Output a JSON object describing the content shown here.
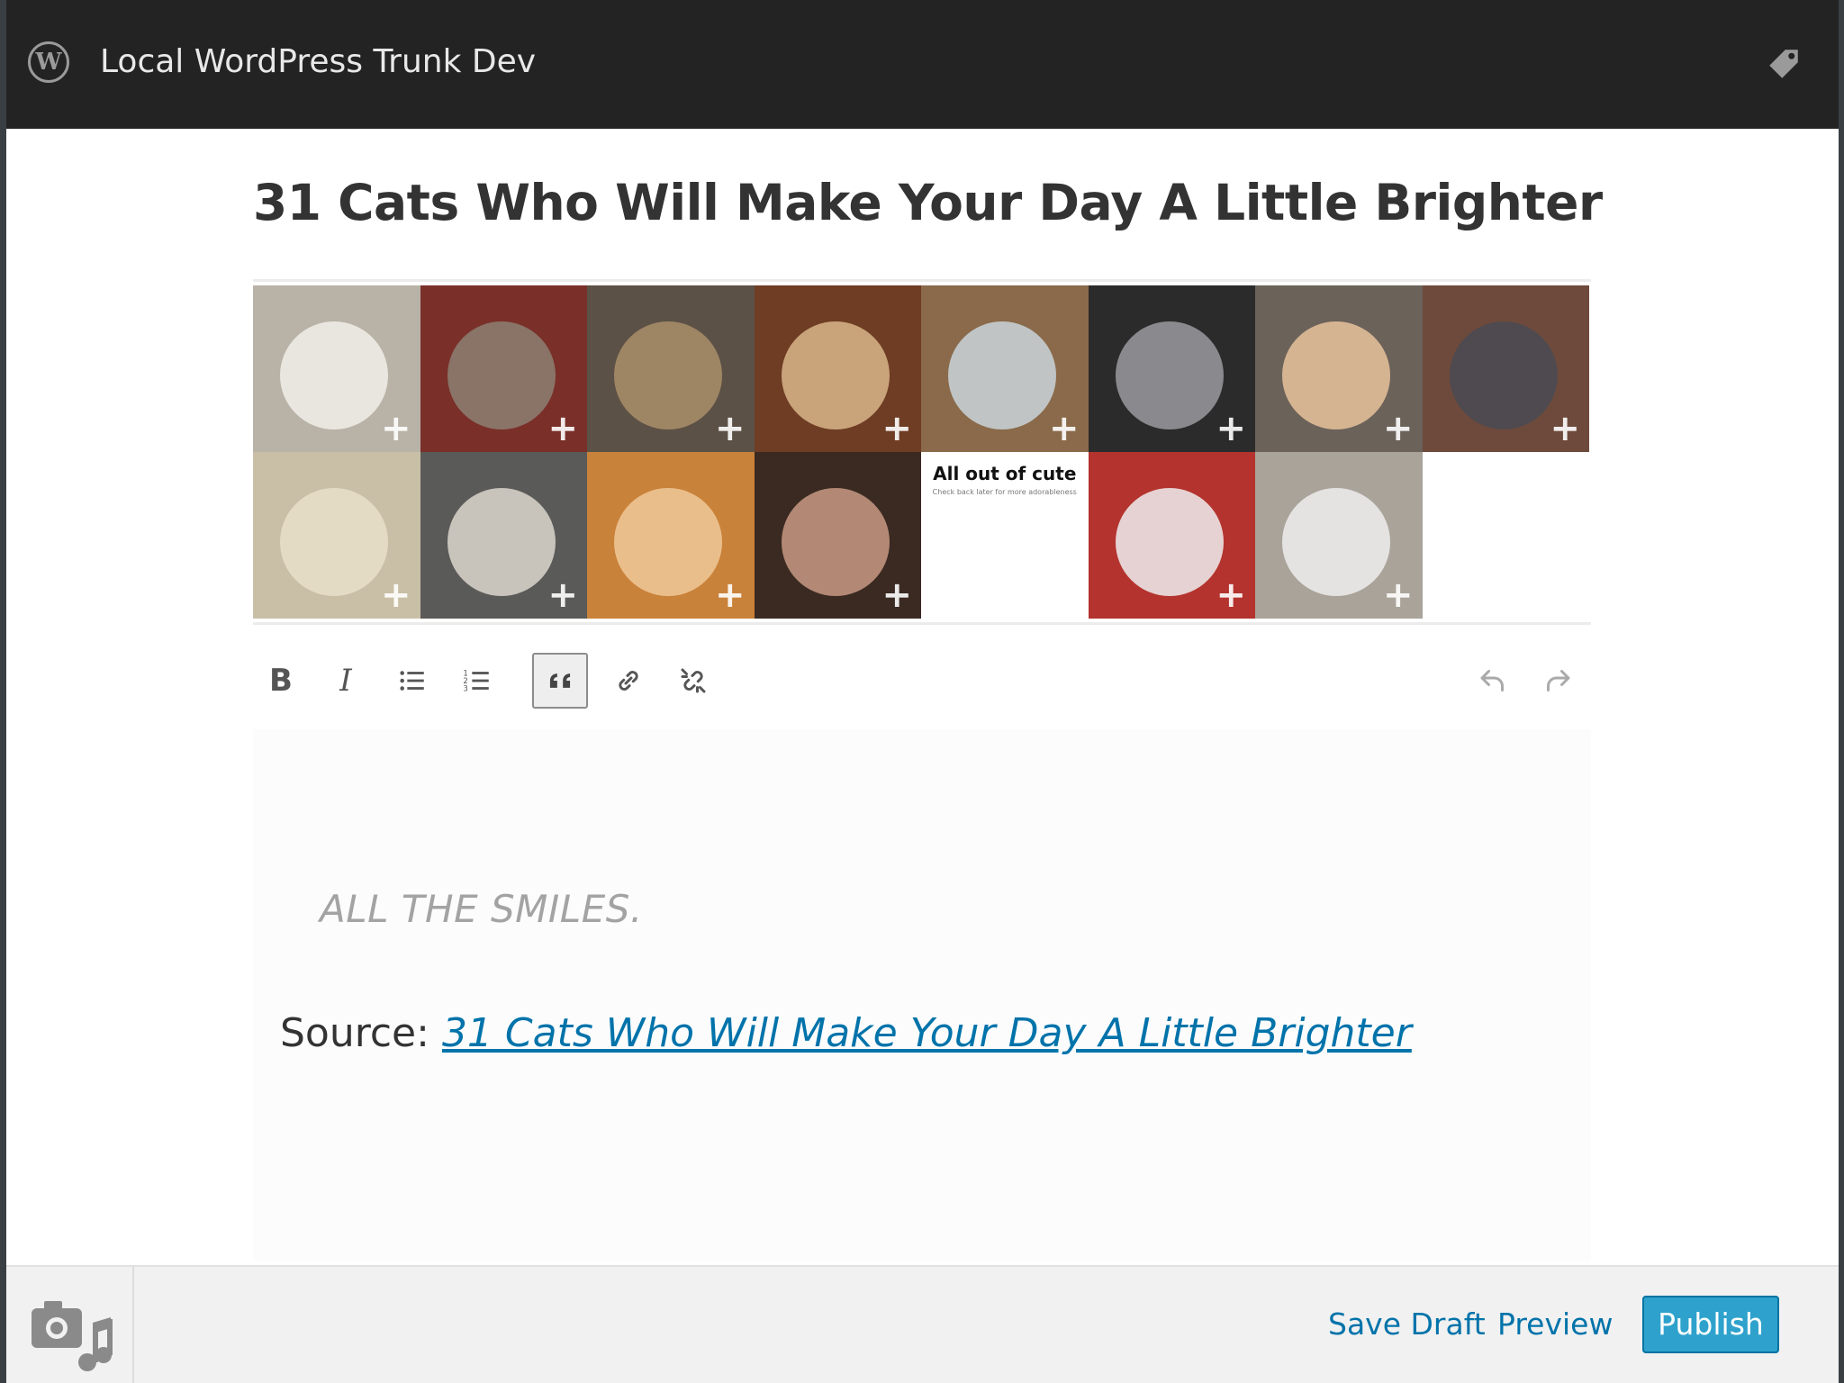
{
  "site": {
    "title": "Local WordPress Trunk Dev",
    "logo_letter": "W"
  },
  "post": {
    "title": "31 Cats Who Will Make Your Day A Little Brighter"
  },
  "gallery": {
    "plus": "+",
    "thumbs": [
      {
        "kind": "photo",
        "bg": "#b9b2a7",
        "accent": "#f1efea"
      },
      {
        "kind": "photo",
        "bg": "#7a2f29",
        "accent": "#8d7f72"
      },
      {
        "kind": "photo",
        "bg": "#5c5146",
        "accent": "#a98e6a"
      },
      {
        "kind": "photo",
        "bg": "#6e3d24",
        "accent": "#d9b58a"
      },
      {
        "kind": "photo",
        "bg": "#8a6a4a",
        "accent": "#c9d4da"
      },
      {
        "kind": "photo",
        "bg": "#2b2b2b",
        "accent": "#9a9aa0"
      },
      {
        "kind": "photo",
        "bg": "#6b625a",
        "accent": "#e7c39c"
      },
      {
        "kind": "photo",
        "bg": "#6e4a3c",
        "accent": "#4a4a52"
      },
      {
        "kind": "photo",
        "bg": "#c9bfa6",
        "accent": "#e9dfc9"
      },
      {
        "kind": "photo",
        "bg": "#5a5a58",
        "accent": "#dcd6cc"
      },
      {
        "kind": "photo",
        "bg": "#c9823a",
        "accent": "#f0c99a"
      },
      {
        "kind": "photo",
        "bg": "#3a2a22",
        "accent": "#c99a84"
      },
      {
        "kind": "text",
        "bg": "#ffffff",
        "title": "All out of cute",
        "sub": "Check back later for more adorableness"
      },
      {
        "kind": "photo",
        "bg": "#b4332e",
        "accent": "#efefef"
      },
      {
        "kind": "photo",
        "bg": "#a9a39a",
        "accent": "#efefef"
      }
    ]
  },
  "toolbar": {
    "bold": "B",
    "italic": "I",
    "bullet_list": "bullet-list-icon",
    "numbered_list": "numbered-list-icon",
    "blockquote": "blockquote-icon",
    "link": "link-icon",
    "unlink": "unlink-icon",
    "undo": "undo-icon",
    "redo": "redo-icon"
  },
  "content": {
    "quote": "ALL THE SMILES.",
    "source_label": "Source: ",
    "source_link": "31 Cats Who Will Make Your Day A Little Brighter"
  },
  "footer": {
    "save_draft": "Save Draft",
    "preview": "Preview",
    "publish": "Publish"
  },
  "colors": {
    "topbar": "#232323",
    "link": "#0073aa",
    "publish": "#2ea2cc"
  }
}
